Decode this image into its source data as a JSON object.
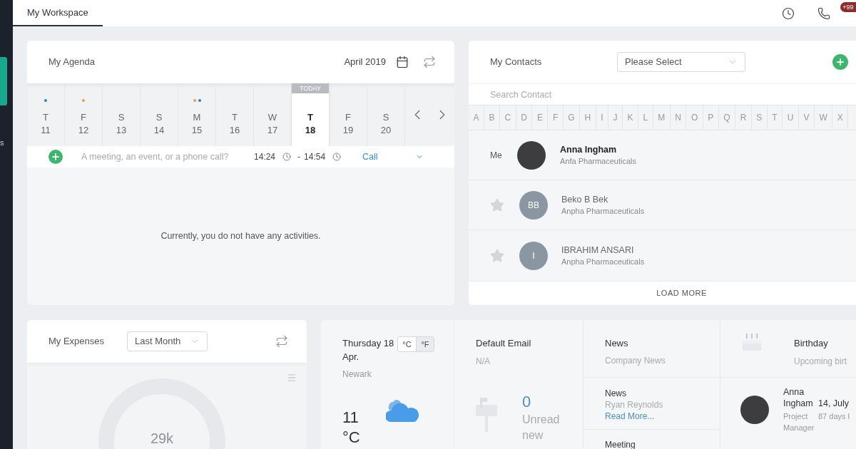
{
  "sidebar": {
    "items": [
      {
        "selected": true
      },
      {
        "label": "s",
        "selected": false
      }
    ]
  },
  "top_bar": {
    "tabs": [
      {
        "label": "My Workspace",
        "selected": true
      }
    ],
    "notification_badge": "+99"
  },
  "agenda": {
    "title": "My Agenda",
    "month": "April 2019",
    "today_label": "TODAY",
    "days": [
      {
        "weekday": "T",
        "date": "11",
        "selected": false,
        "events": [
          {
            "color": "#2f80d1"
          }
        ]
      },
      {
        "weekday": "F",
        "date": "12",
        "selected": false,
        "events": [
          {
            "color": "#e8a43c"
          }
        ]
      },
      {
        "weekday": "S",
        "date": "13",
        "selected": false
      },
      {
        "weekday": "S",
        "date": "14",
        "selected": false
      },
      {
        "weekday": "M",
        "date": "15",
        "selected": false,
        "events": [
          {
            "color": "#e8a43c"
          },
          {
            "color": "#2f80d1"
          }
        ]
      },
      {
        "weekday": "T",
        "date": "16",
        "selected": false
      },
      {
        "weekday": "W",
        "date": "17",
        "selected": false
      },
      {
        "weekday": "T",
        "date": "18",
        "selected": true
      },
      {
        "weekday": "F",
        "date": "19",
        "selected": false
      },
      {
        "weekday": "S",
        "date": "20",
        "selected": false
      }
    ],
    "new_activity": {
      "placeholder": "A meeting, an event, or a phone call?",
      "start": "14:24",
      "separator": "-",
      "end": "14:54",
      "type": "Call"
    },
    "empty_message": "Currently, you do not have any activities."
  },
  "contacts": {
    "title": "My Contacts",
    "filter": {
      "placeholder": "Please Select"
    },
    "search": {
      "placeholder": "Search Contact"
    },
    "letters": [
      "A",
      "B",
      "C",
      "D",
      "E",
      "F",
      "G",
      "H",
      "I",
      "J",
      "K",
      "L",
      "M",
      "N",
      "O",
      "P",
      "Q",
      "R",
      "S",
      "T",
      "U",
      "V",
      "W",
      "X"
    ],
    "rows": [
      {
        "kind": "me",
        "tag": "Me",
        "name": "Anna Ingham",
        "company": "Anfa Pharmaceuticals"
      },
      {
        "kind": "contact",
        "favorite": false,
        "initials": "BB",
        "name": "Beko B Bek",
        "company": "Anpha Pharmaceuticals"
      },
      {
        "kind": "contact",
        "favorite": false,
        "initials": "I",
        "name": "IBRAHIM ANSARI",
        "company": "Anpha Pharmaceuticals"
      }
    ],
    "load_more": "LOAD MORE"
  },
  "expenses": {
    "title": "My Expenses",
    "period": {
      "value": "Last Month"
    },
    "total": "29k"
  },
  "weather": {
    "date": "Thursday 18 Apr.",
    "units": [
      {
        "label": "°C",
        "selected": true
      },
      {
        "label": "°F",
        "selected": false
      }
    ],
    "city": "Newark",
    "temperature": "11",
    "temperature_unit": "°C"
  },
  "email": {
    "title": "Default Email",
    "address": "N/A",
    "unread_count": "0",
    "unread_label": "Unread new"
  },
  "news": {
    "items": [
      {
        "title": "News",
        "text": "Company News"
      },
      {
        "title": "News",
        "text": "Ryan Reynolds",
        "link": "Read More..."
      },
      {
        "title": "Meeting"
      }
    ]
  },
  "birthday": {
    "title": "Birthday",
    "subtitle": "Upcoming birt",
    "people": [
      {
        "name": "Anna Ingham",
        "date": "14, July",
        "role": "Project Manager",
        "countdown": "87 days l"
      }
    ]
  }
}
